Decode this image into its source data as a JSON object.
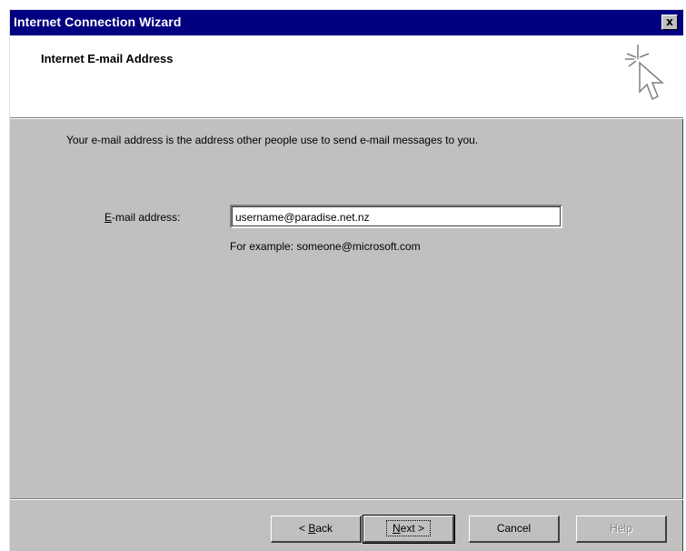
{
  "window": {
    "title": "Internet Connection Wizard",
    "close_label": "x"
  },
  "header": {
    "heading": "Internet E-mail Address",
    "icon": "wizard-cursor-sparkle-icon"
  },
  "body": {
    "intro": "Your e-mail address is the address other people use to send e-mail messages to you.",
    "email_label_accel": "E",
    "email_label_rest": "-mail address:",
    "email_value": "username@paradise.net.nz",
    "example": "For example: someone@microsoft.com"
  },
  "buttons": {
    "back_prefix": "< ",
    "back_accel": "B",
    "back_rest": "ack",
    "next_accel": "N",
    "next_rest": "ext >",
    "cancel": "Cancel",
    "help": "Help"
  },
  "colors": {
    "titlebar": "#000080",
    "face": "#c0c0c0"
  }
}
